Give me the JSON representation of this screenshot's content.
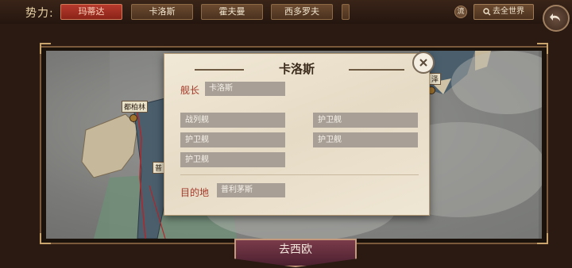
{
  "topbar": {
    "faction_label": "势力:",
    "factions": [
      {
        "label": "玛蒂达",
        "active": true
      },
      {
        "label": "卡洛斯",
        "active": false
      },
      {
        "label": "霍夫曼",
        "active": false
      },
      {
        "label": "西多罗夫",
        "active": false
      }
    ],
    "flow_label": "流",
    "world_button": "去全世界"
  },
  "map": {
    "city_left": "都柏林",
    "city_partial": "普",
    "city_right": "泽"
  },
  "go_button": "去西欧",
  "dialog": {
    "title": "卡洛斯",
    "captain_label": "舰长",
    "captain_value": "卡洛斯",
    "ships": [
      "战列舰",
      "护卫舰",
      "护卫舰",
      "护卫舰",
      "护卫舰"
    ],
    "destination_label": "目的地",
    "destination_value": "普利茅斯"
  },
  "colors": {
    "active_tab": "#b73a2d",
    "label_red": "#a33a2a",
    "field_gray": "#a8a096"
  }
}
